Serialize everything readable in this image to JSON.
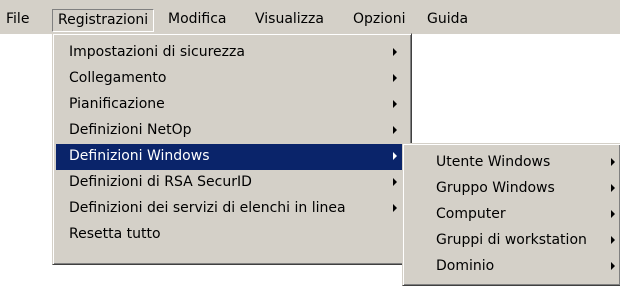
{
  "menubar": {
    "items": [
      {
        "label": "File"
      },
      {
        "label": "Registrazioni"
      },
      {
        "label": "Modifica"
      },
      {
        "label": "Visualizza"
      },
      {
        "label": "Opzioni"
      },
      {
        "label": "Guida"
      }
    ]
  },
  "registrazioni_menu": {
    "items": [
      {
        "label": "Impostazioni di sicurezza",
        "has_submenu": true
      },
      {
        "label": "Collegamento",
        "has_submenu": true
      },
      {
        "label": "Pianificazione",
        "has_submenu": true
      },
      {
        "label": "Definizioni NetOp",
        "has_submenu": true
      },
      {
        "label": "Definizioni Windows",
        "has_submenu": true,
        "highlighted": true
      },
      {
        "label": "Definizioni di RSA SecurID",
        "has_submenu": true
      },
      {
        "label": "Definizioni dei servizi di elenchi in linea",
        "has_submenu": true
      },
      {
        "label": "Resetta tutto",
        "has_submenu": false
      }
    ]
  },
  "windows_submenu": {
    "items": [
      {
        "label": "Utente Windows",
        "has_submenu": true
      },
      {
        "label": "Gruppo Windows",
        "has_submenu": true
      },
      {
        "label": "Computer",
        "has_submenu": true
      },
      {
        "label": "Gruppi di workstation",
        "has_submenu": true
      },
      {
        "label": "Dominio",
        "has_submenu": true
      }
    ]
  },
  "colors": {
    "menu_background": "#d4d0c8",
    "highlight_background": "#0a246a",
    "highlight_text": "#ffffff"
  }
}
